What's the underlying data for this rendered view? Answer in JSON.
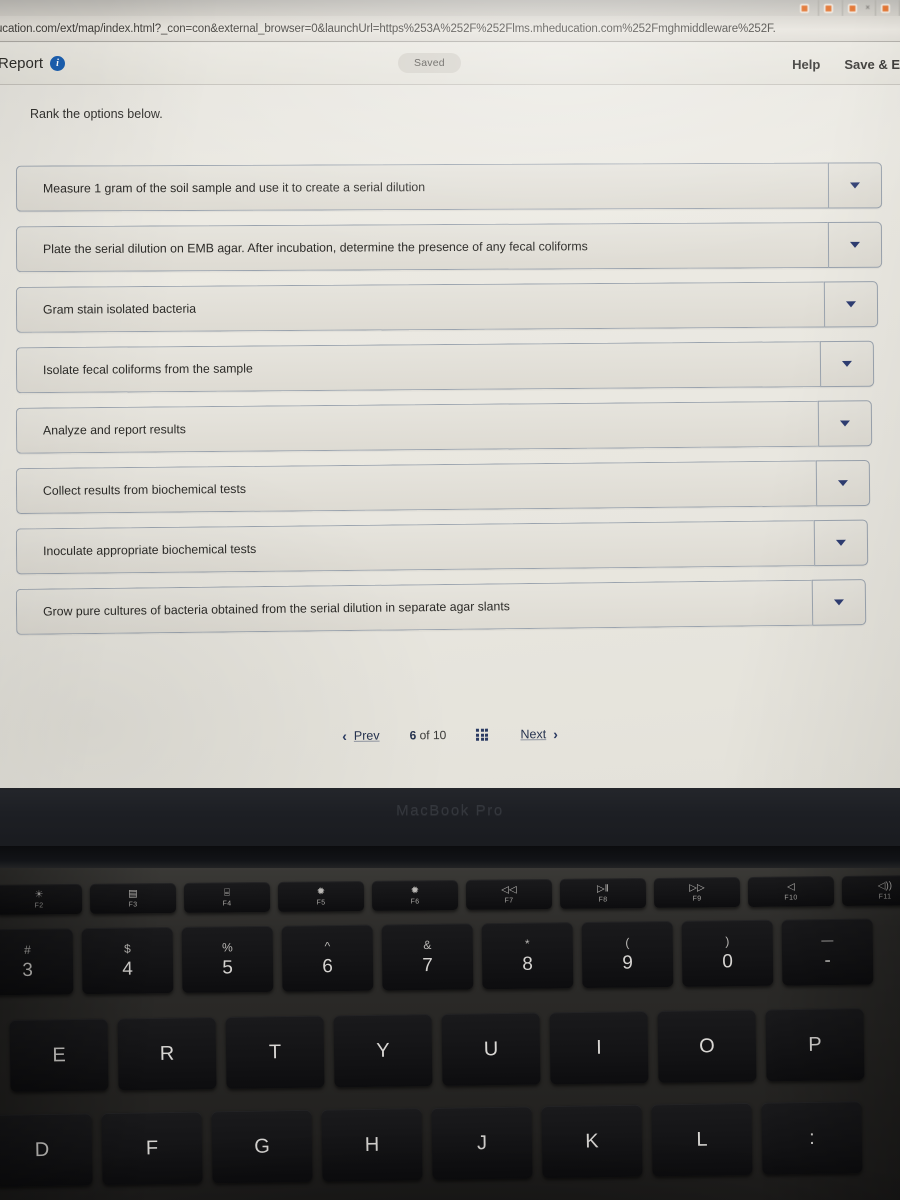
{
  "browser": {
    "url": "ucation.com/ext/map/index.html?_con=con&external_browser=0&launchUrl=https%253A%252F%252Flms.mheducation.com%252Fmghmiddleware%252F.",
    "tabs": [
      {
        "title": "",
        "close": ""
      },
      {
        "title": "",
        "close": ""
      },
      {
        "title": "",
        "close": ""
      },
      {
        "title": "",
        "close": "×"
      },
      {
        "title": "",
        "close": ""
      }
    ]
  },
  "header": {
    "title": "Report",
    "info_icon": "i",
    "saved_label": "Saved",
    "help_label": "Help",
    "save_exit_label": "Save & E"
  },
  "question": {
    "prompt": "Rank the options below.",
    "options": [
      {
        "text": "Measure 1 gram of the soil sample and use it to create a serial dilution",
        "selected": ""
      },
      {
        "text": "Plate the serial dilution on EMB agar. After incubation, determine the presence of any fecal coliforms",
        "selected": ""
      },
      {
        "text": "Gram stain isolated bacteria",
        "selected": ""
      },
      {
        "text": "Isolate fecal coliforms from the sample",
        "selected": ""
      },
      {
        "text": "Analyze and report results",
        "selected": ""
      },
      {
        "text": "Collect results from biochemical tests",
        "selected": ""
      },
      {
        "text": "Inoculate appropriate biochemical tests",
        "selected": ""
      },
      {
        "text": "Grow pure cultures of bacteria obtained from the serial dilution in separate agar slants",
        "selected": ""
      }
    ]
  },
  "pager": {
    "prev_label": "Prev",
    "prev_chevron": "‹",
    "current_page": "6",
    "of_label": "of",
    "total_pages": "10",
    "grid_icon": "grid-icon",
    "next_label": "Next",
    "next_chevron": "›"
  },
  "laptop": {
    "brand": "MacBook Pro",
    "function_keys": [
      {
        "glyph": "☀",
        "label": "F2",
        "name": "brightness-up-key"
      },
      {
        "glyph": "▤",
        "label": "F3",
        "name": "mission-control-key"
      },
      {
        "glyph": "⌸",
        "label": "F4",
        "name": "launchpad-key"
      },
      {
        "glyph": "✹",
        "label": "F5",
        "name": "keyboard-brightness-down-key"
      },
      {
        "glyph": "✹",
        "label": "F6",
        "name": "keyboard-brightness-up-key"
      },
      {
        "glyph": "◁◁",
        "label": "F7",
        "name": "rewind-key"
      },
      {
        "glyph": "▷‖",
        "label": "F8",
        "name": "play-pause-key"
      },
      {
        "glyph": "▷▷",
        "label": "F9",
        "name": "fast-forward-key"
      },
      {
        "glyph": "◁",
        "label": "F10",
        "name": "mute-key"
      },
      {
        "glyph": "◁))",
        "label": "F11",
        "name": "volume-down-key"
      }
    ],
    "number_keys": [
      {
        "top": "#",
        "bottom": "3"
      },
      {
        "top": "$",
        "bottom": "4"
      },
      {
        "top": "%",
        "bottom": "5"
      },
      {
        "top": "^",
        "bottom": "6"
      },
      {
        "top": "&",
        "bottom": "7"
      },
      {
        "top": "*",
        "bottom": "8"
      },
      {
        "top": "(",
        "bottom": "9"
      },
      {
        "top": ")",
        "bottom": "0"
      },
      {
        "top": "—",
        "bottom": "-"
      }
    ],
    "letter_row_top": [
      "E",
      "R",
      "T",
      "Y",
      "U",
      "I",
      "O",
      "P"
    ],
    "letter_row_bottom": [
      "D",
      "F",
      "G",
      "H",
      "J",
      "K",
      "L",
      ":"
    ]
  },
  "colors": {
    "screen_bg": "#e8e6de",
    "accent_blue": "#26334f",
    "caret_blue": "#2e3d72",
    "info_blue": "#1b5fb0",
    "option_border": "#9aa3ae",
    "deck_dark": "#262523"
  }
}
